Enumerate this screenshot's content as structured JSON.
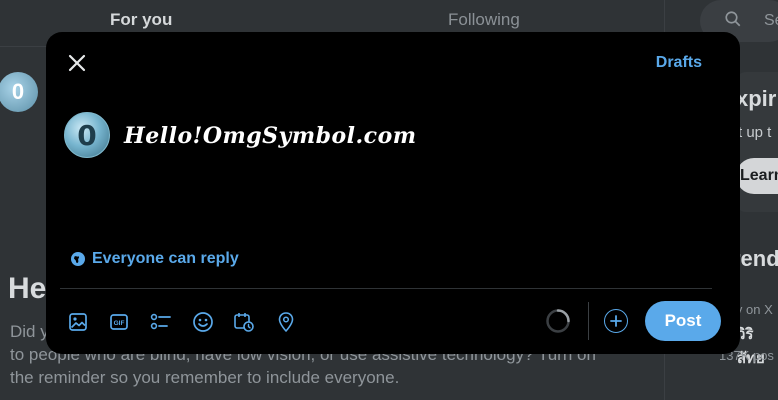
{
  "background": {
    "tabs": {
      "for_you": "For you",
      "following": "Following"
    },
    "avatar_letter": "0",
    "heading": "He",
    "paragraph_lines": [
      "Did y",
      "to people who are blind, have low vision, or use assistive technology? Turn on",
      "the reminder so you remember to include everyone."
    ],
    "search_placeholder": "Se",
    "card": {
      "title": "xpir",
      "subtitle": "t up t",
      "button": "Learn"
    },
    "trends": {
      "title": "rend",
      "line1": "ly on X",
      "line2": "วิริสัทย",
      "line3": "137K pos"
    }
  },
  "modal": {
    "drafts_label": "Drafts",
    "avatar_letter": "0",
    "compose_text": "Hello!OmgSymbol.com",
    "reply_setting": "Everyone can reply",
    "post_label": "Post",
    "toolbar_icons": [
      "image-icon",
      "gif-icon",
      "poll-icon",
      "emoji-icon",
      "schedule-icon",
      "location-icon"
    ]
  },
  "colors": {
    "accent": "#5aa9ea",
    "modal_bg": "#000000",
    "overlay": "#2f3336"
  }
}
